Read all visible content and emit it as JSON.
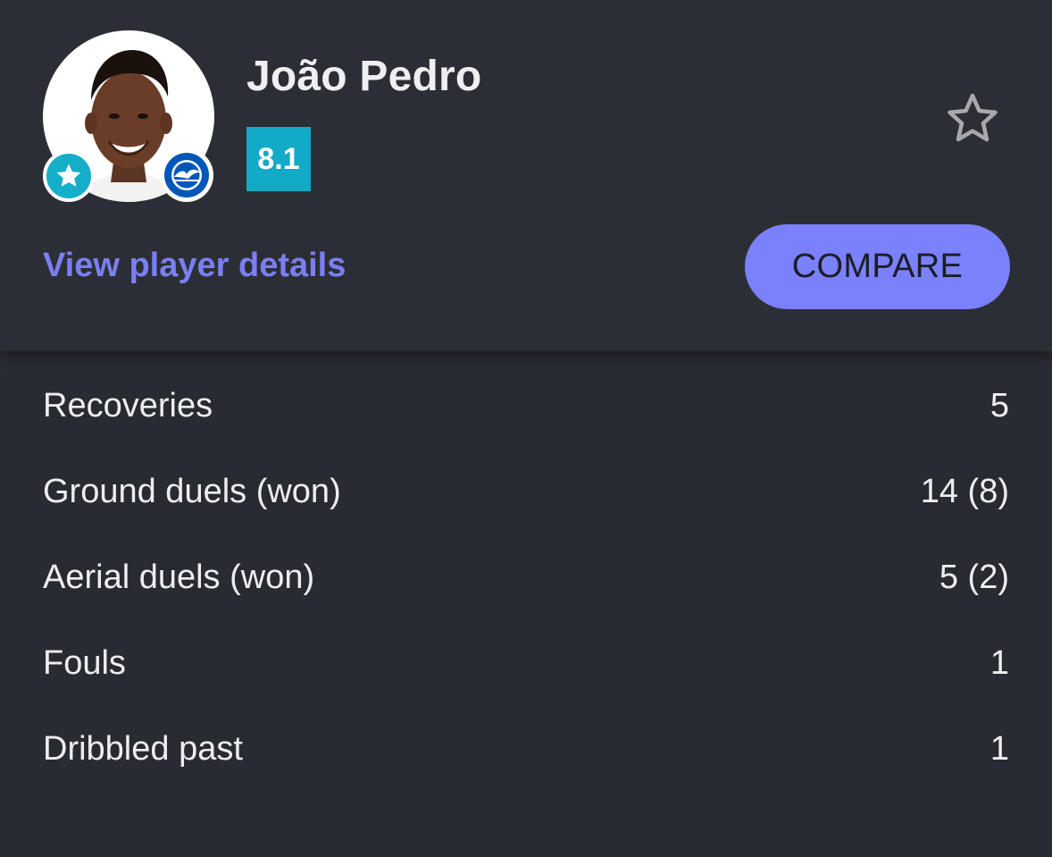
{
  "player": {
    "name": "João Pedro",
    "rating": "8.1"
  },
  "header": {
    "details_link": "View player details",
    "compare_label": "COMPARE"
  },
  "colors": {
    "rating_badge": "#12aac6",
    "accent": "#7b80fb",
    "link": "#7b7ff2",
    "background": "#282b32"
  },
  "icons": {
    "favorite": "star-outline-icon",
    "top_player": "star-icon",
    "club": "brighton-crest-icon"
  },
  "stats": [
    {
      "label": "Recoveries",
      "value": "5"
    },
    {
      "label": "Ground duels (won)",
      "value": "14 (8)"
    },
    {
      "label": "Aerial duels (won)",
      "value": "5 (2)"
    },
    {
      "label": "Fouls",
      "value": "1"
    },
    {
      "label": "Dribbled past",
      "value": "1"
    }
  ]
}
